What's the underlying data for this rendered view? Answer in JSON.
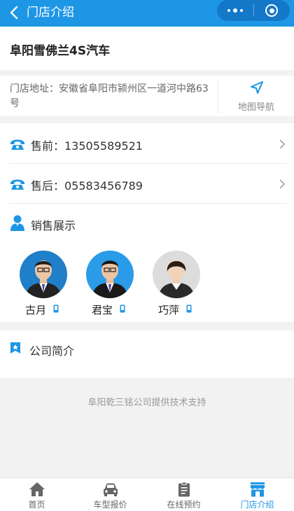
{
  "header": {
    "title": "门店介绍",
    "back_icon": "chevron-left-icon",
    "menu_icon": "more-dots-icon",
    "close_icon": "record-circle-icon",
    "color": "#1e96e6"
  },
  "store": {
    "name": "阜阳雪佛兰4S汽车",
    "address": "门店地址：安徽省阜阳市颍州区一道河中路63号",
    "nav_label": "地图导航",
    "nav_icon": "navigation-arrow-icon"
  },
  "contacts": {
    "pre_sale": "售前：13505589521",
    "after_sale": "售后：05583456789",
    "icon": "phone-icon"
  },
  "sales": {
    "title": "销售展示",
    "icon": "user-icon",
    "people": [
      {
        "name": "古月",
        "icon": "mobile-phone-icon"
      },
      {
        "name": "君宝",
        "icon": "mobile-phone-icon"
      },
      {
        "name": "巧萍",
        "icon": "mobile-phone-icon"
      }
    ]
  },
  "intro": {
    "title": "公司简介",
    "icon": "bookmark-icon"
  },
  "footer": {
    "note": "阜阳乾三铭公司提供技术支持"
  },
  "tabbar": {
    "active_color": "#1e96e6",
    "items": [
      {
        "label": "首页",
        "icon": "home-icon",
        "active": false
      },
      {
        "label": "车型报价",
        "icon": "car-icon",
        "active": false
      },
      {
        "label": "在线预约",
        "icon": "clipboard-icon",
        "active": false
      },
      {
        "label": "门店介绍",
        "icon": "store-icon",
        "active": true
      }
    ]
  }
}
